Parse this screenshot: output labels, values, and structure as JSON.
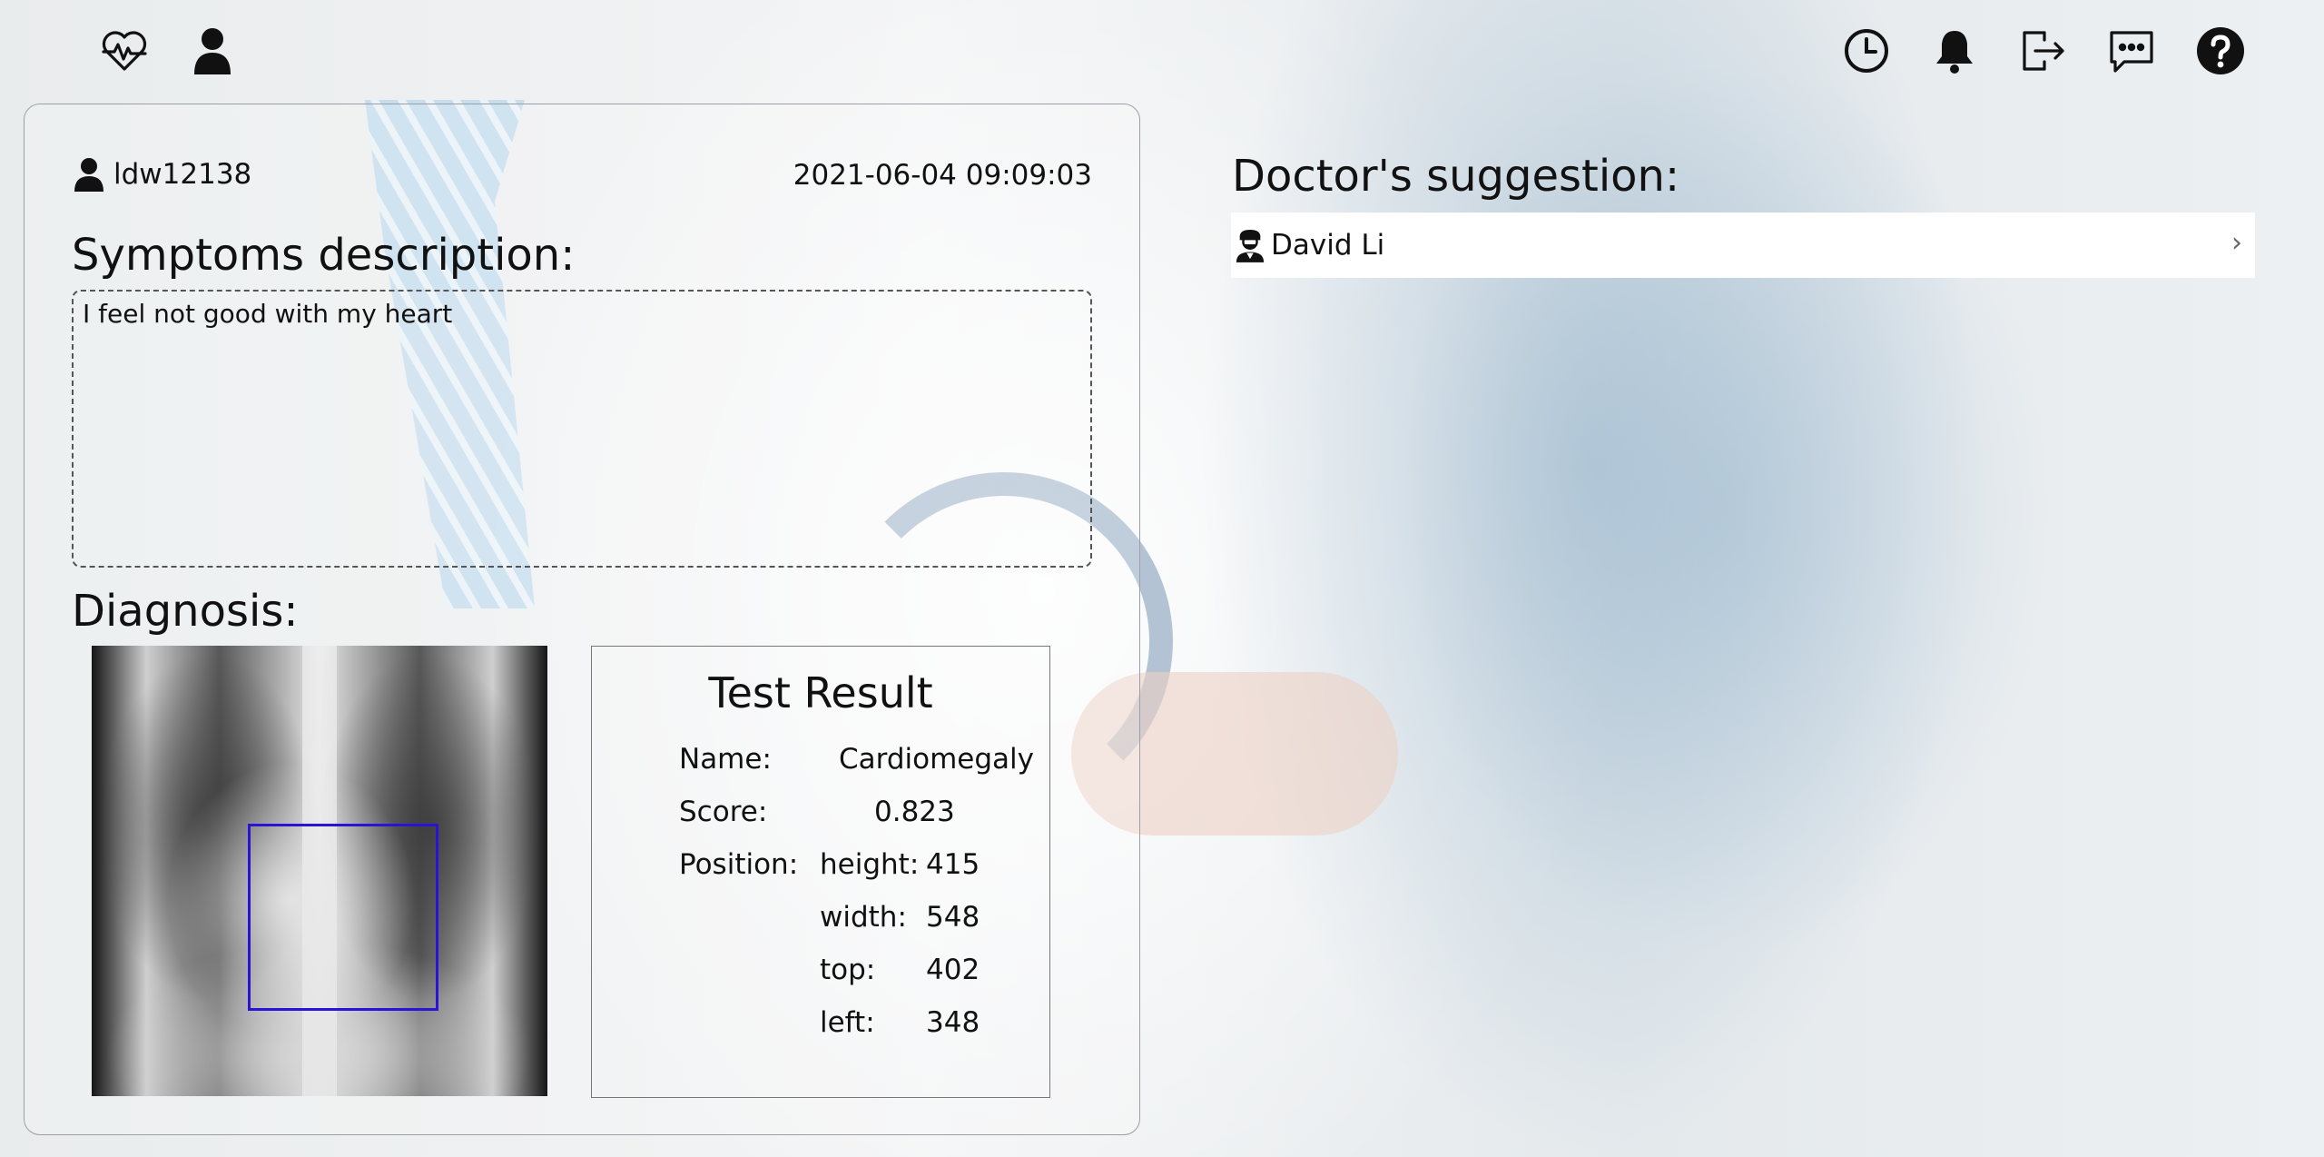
{
  "header": {
    "left_icons": [
      "heart-pulse-icon",
      "user-icon"
    ],
    "right_icons": [
      "history-clock-icon",
      "bell-icon",
      "logout-icon",
      "chat-icon",
      "help-icon"
    ]
  },
  "record": {
    "username": "ldw12138",
    "timestamp": "2021-06-04 09:09:03",
    "symptoms_title": "Symptoms description:",
    "symptoms_text": "I feel not good with my heart",
    "diagnosis_title": "Diagnosis:"
  },
  "test_result": {
    "title": "Test Result",
    "name_label": "Name:",
    "name_value": "Cardiomegaly",
    "score_label": "Score:",
    "score_value": "0.823",
    "position_label": "Position:",
    "height_label": "height:",
    "height_value": "415",
    "width_label": "width:",
    "width_value": "548",
    "top_label": "top:",
    "top_value": "402",
    "left_label": "left:",
    "left_value": "348"
  },
  "doctor": {
    "title": "Doctor's suggestion:",
    "name": "David Li",
    "chevron": "›"
  },
  "colors": {
    "bbox": "#2a13d6"
  }
}
